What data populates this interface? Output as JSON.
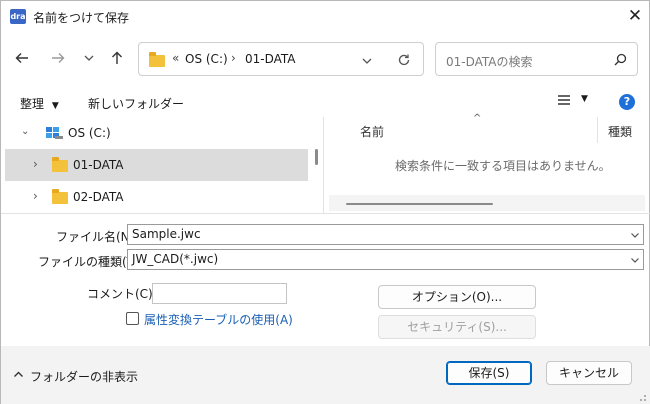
{
  "window": {
    "app_icon_text": "dra",
    "title": "名前をつけて保存"
  },
  "nav": {
    "back_icon": "arrow-left",
    "forward_icon": "arrow-right",
    "recent_icon": "chevron-down",
    "up_icon": "arrow-up",
    "breadcrumb": {
      "overflow": "«",
      "items": [
        "OS (C:)",
        "01-DATA"
      ]
    },
    "search_placeholder": "01-DATAの検索"
  },
  "toolbar": {
    "organize_label": "整理",
    "new_folder_label": "新しいフォルダー"
  },
  "tree": {
    "drive": {
      "label": "OS (C:)"
    },
    "items": [
      {
        "label": "01-DATA",
        "selected": true
      },
      {
        "label": "02-DATA",
        "selected": false
      }
    ]
  },
  "filelist": {
    "columns": [
      "名前",
      "種類"
    ],
    "empty_message": "検索条件に一致する項目はありません。"
  },
  "form": {
    "filename_label": "ファイル名(N):",
    "filename_value": "Sample.jwc",
    "filetype_label": "ファイルの種類(T):",
    "filetype_value": "JW_CAD(*.jwc)",
    "comment_label": "コメント(C) :",
    "comment_value": "",
    "attr_table_label": "属性変換テーブルの使用(A)",
    "attr_table_checked": false,
    "options_label": "オプション(O)...",
    "security_label": "セキュリティ(S)..."
  },
  "footer": {
    "hide_folders_label": "フォルダーの非表示",
    "save_label": "保存(S)",
    "cancel_label": "キャンセル"
  },
  "colors": {
    "accent": "#0067c0",
    "link": "#1a5fb4",
    "folder": "#f3c13a",
    "selection": "#dcdcdc"
  }
}
